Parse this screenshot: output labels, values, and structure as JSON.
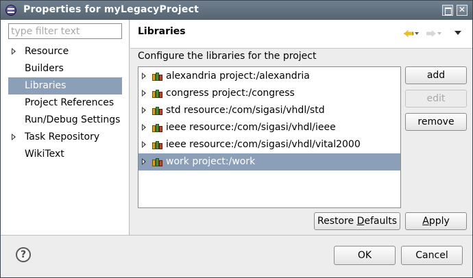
{
  "window": {
    "title": "Properties for myLegacyProject",
    "close_glyph": "✕"
  },
  "sidebar": {
    "filter_placeholder": "type filter text",
    "items": [
      {
        "label": "Resource",
        "expandable": true
      },
      {
        "label": "Builders",
        "expandable": false
      },
      {
        "label": "Libraries",
        "expandable": false,
        "selected": true
      },
      {
        "label": "Project References",
        "expandable": false
      },
      {
        "label": "Run/Debug Settings",
        "expandable": false
      },
      {
        "label": "Task Repository",
        "expandable": true
      },
      {
        "label": "WikiText",
        "expandable": false
      }
    ]
  },
  "page": {
    "title": "Libraries",
    "description": "Configure the libraries for the project"
  },
  "libraries": [
    {
      "label": "alexandria project:/alexandria"
    },
    {
      "label": "congress project:/congress"
    },
    {
      "label": "std resource:/com/sigasi/vhdl/std"
    },
    {
      "label": "ieee resource:/com/sigasi/vhdl/ieee"
    },
    {
      "label": "ieee resource:/com/sigasi/vhdl/vital2000"
    },
    {
      "label": "work project:/work",
      "selected": true
    }
  ],
  "buttons": {
    "add": "add",
    "edit": "edit",
    "remove": "remove",
    "restore_pre": "Restore ",
    "restore_mn": "D",
    "restore_post": "efaults",
    "apply_mn": "A",
    "apply_post": "pply",
    "ok": "OK",
    "cancel": "Cancel",
    "help": "?"
  },
  "colors": {
    "selection": "#8c9fb8",
    "titlebar": "#5f6d7a",
    "back_arrow": "#e6c12a"
  },
  "icons": {
    "app": "eclipse-icon",
    "library": "library-books-icon",
    "help": "help-icon"
  }
}
